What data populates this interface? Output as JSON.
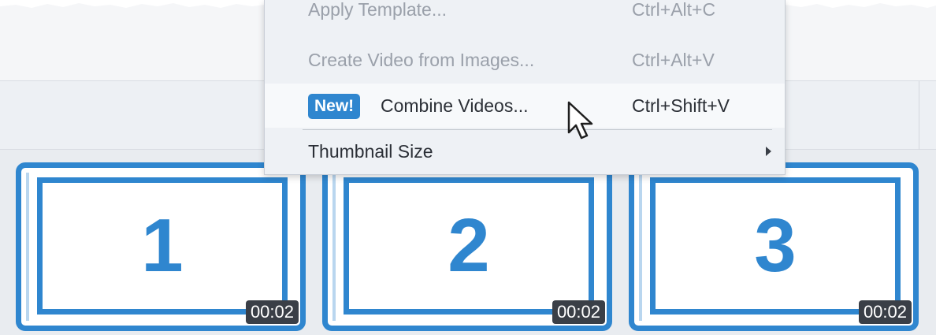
{
  "menu": {
    "items": [
      {
        "label": "Apply Template...",
        "shortcut": "Ctrl+Alt+C",
        "state": "disabled"
      },
      {
        "label": "Create Video from Images...",
        "shortcut": "Ctrl+Alt+V",
        "state": "disabled"
      },
      {
        "badge": "New!",
        "label": "Combine Videos...",
        "shortcut": "Ctrl+Shift+V",
        "state": "hover"
      },
      {
        "label": "Thumbnail Size",
        "submenu": true,
        "state": "enabled"
      }
    ]
  },
  "clips": [
    {
      "number": "1",
      "duration": "00:02"
    },
    {
      "number": "2",
      "duration": "00:02"
    },
    {
      "number": "3",
      "duration": "00:02"
    }
  ],
  "colors": {
    "accent": "#2f86cf",
    "duration_badge": "#3a3f47",
    "menu_bg": "#eef1f5",
    "disabled_text": "#9aa0aa"
  },
  "icons": {
    "cursor": "pointer-arrow-icon",
    "submenu": "chevron-right-icon"
  }
}
